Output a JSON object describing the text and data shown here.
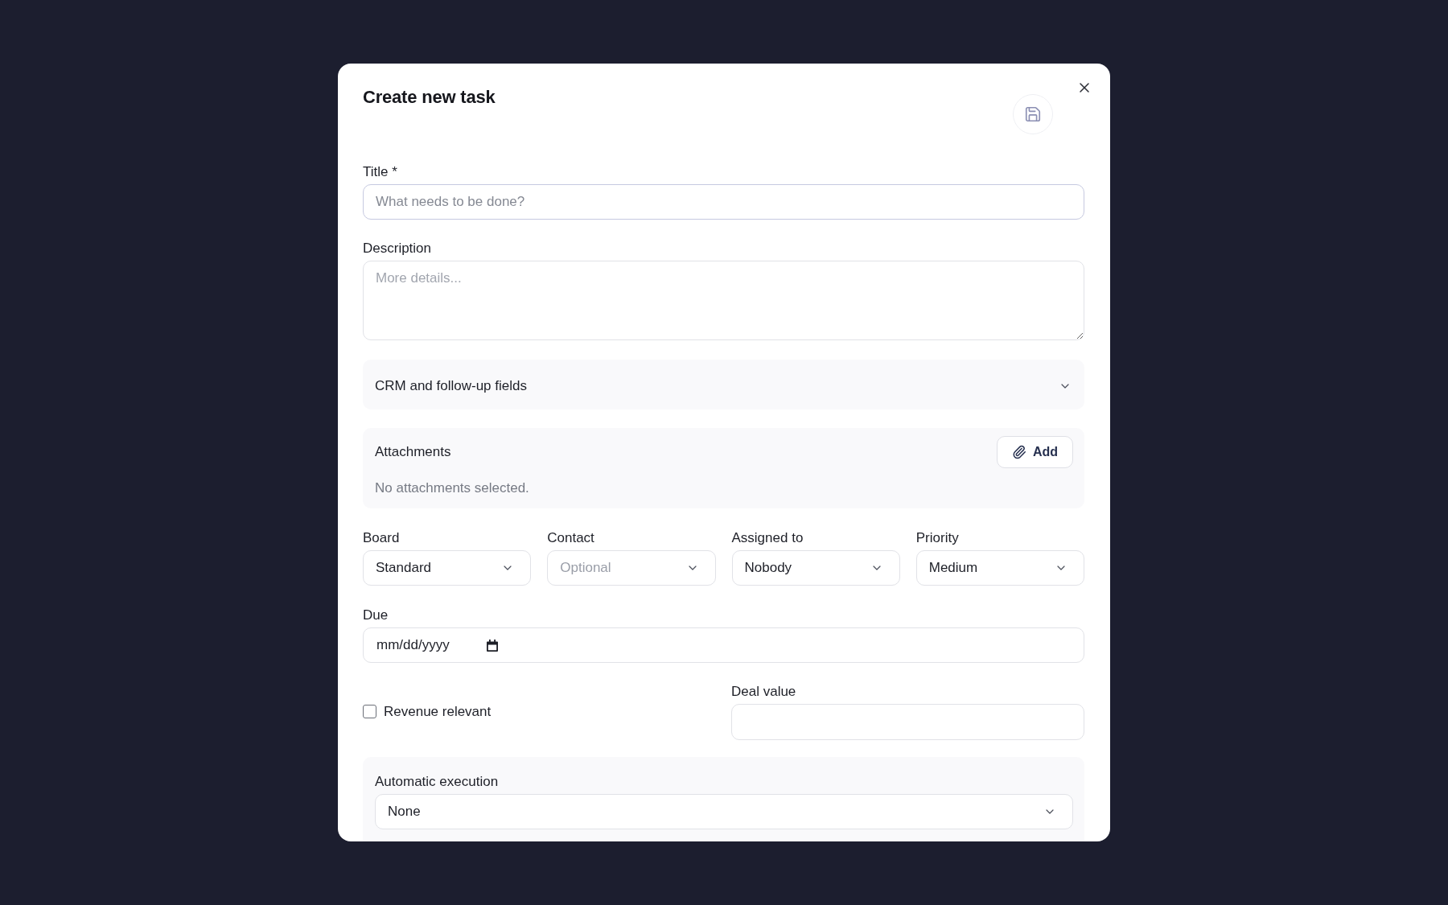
{
  "dialog": {
    "title": "Create new task"
  },
  "title_field": {
    "label": "Title *",
    "placeholder": "What needs to be done?"
  },
  "description_field": {
    "label": "Description",
    "placeholder": "More details..."
  },
  "crm_section": {
    "label": "CRM and follow-up fields",
    "expanded": false
  },
  "attachments": {
    "label": "Attachments",
    "add_button": "Add",
    "empty_text": "No attachments selected."
  },
  "selects": [
    {
      "label": "Board",
      "value": "Standard"
    },
    {
      "label": "Contact",
      "placeholder": "Optional"
    },
    {
      "label": "Assigned to",
      "value": "Nobody"
    },
    {
      "label": "Priority",
      "value": "Medium"
    }
  ],
  "due_field": {
    "label": "Due",
    "placeholder": "mm/dd/yyyy"
  },
  "revenue_relevant": {
    "label": "Revenue relevant",
    "checked": false
  },
  "deal_value": {
    "label": "Deal value"
  },
  "automatic_execution": {
    "label": "Automatic execution",
    "value": "None"
  }
}
